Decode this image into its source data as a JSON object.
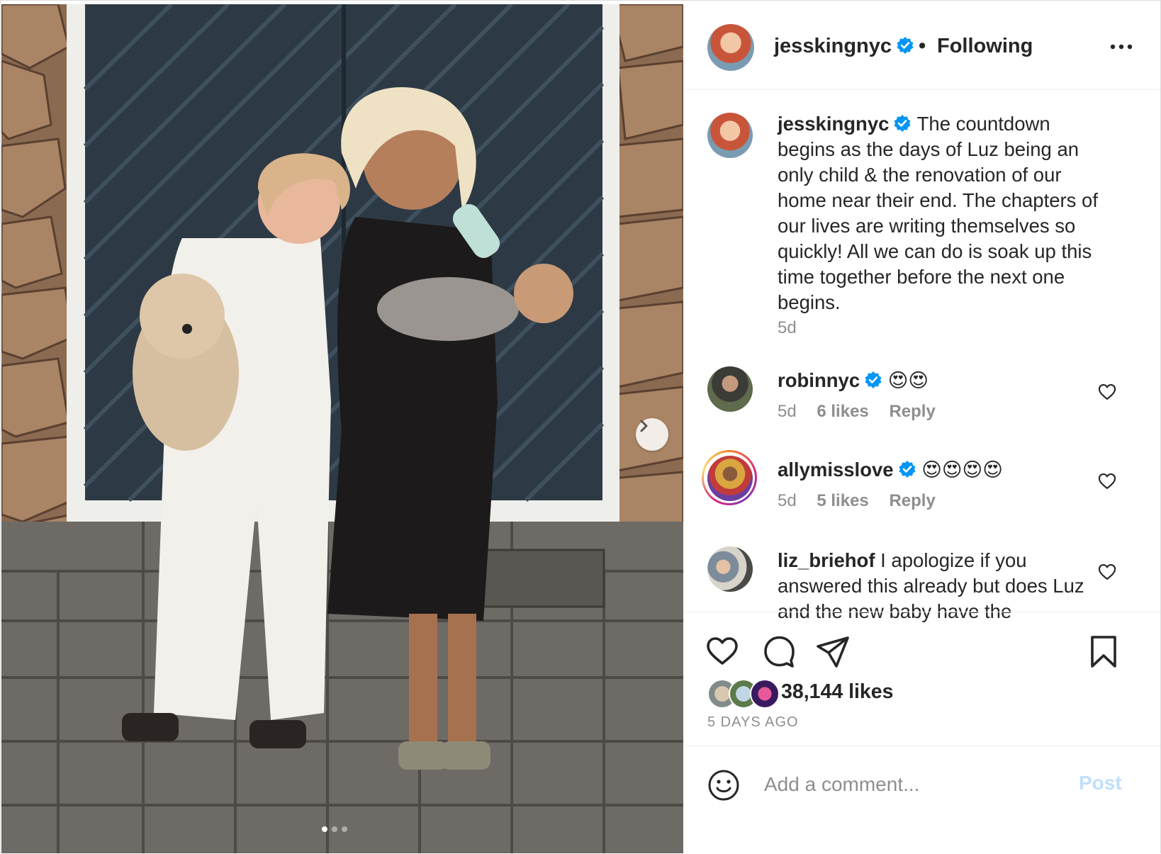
{
  "post": {
    "author": "jesskingnyc",
    "follow_status": "Following",
    "separator": "•",
    "caption": "The countdown begins as the days of Luz being an only child & the renovation of our home near their end. The chapters of our lives are writing themselves so quickly! All we can do is soak up this time together before the next one begins.",
    "caption_time": "5d",
    "likes": "38,144 likes",
    "posted": "5 DAYS AGO",
    "carousel": {
      "count": 3,
      "active": 1
    }
  },
  "comments": [
    {
      "user": "robinnyc",
      "text": "😍😍",
      "time": "5d",
      "likes": "6 likes",
      "reply": "Reply"
    },
    {
      "user": "allymisslove",
      "text": "😍😍😍😍",
      "time": "5d",
      "likes": "5 likes",
      "reply": "Reply"
    },
    {
      "user": "liz_briehof",
      "text": "I apologize if you answered this already but does Luz and the new baby have the",
      "time": "",
      "likes": "",
      "reply": ""
    }
  ],
  "add_comment": {
    "placeholder": "Add a comment...",
    "post_label": "Post"
  },
  "colors": {
    "verified": "#0095f6",
    "post_disabled": "#c0dffd",
    "muted": "#8e8e8e"
  },
  "icons": [
    "verified-badge-icon",
    "more-options-icon",
    "heart-icon",
    "comment-icon",
    "share-icon",
    "bookmark-icon",
    "emoji-icon",
    "chevron-right-icon"
  ]
}
